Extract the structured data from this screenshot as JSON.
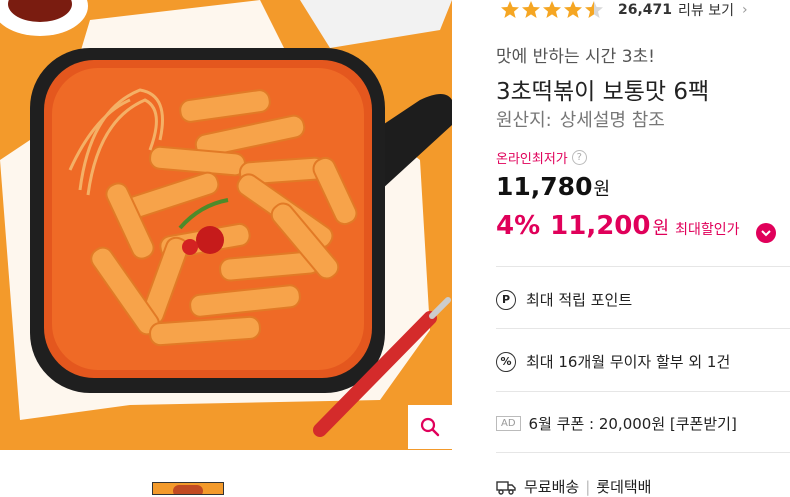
{
  "product": {
    "rating_stars": 4.5,
    "review_count": "26,471",
    "review_link": "리뷰 보기",
    "promo_text": "맛에 반하는 시간 3초!",
    "title": "3초떡볶이 보통맛 6팩",
    "origin_label": "원산지:",
    "origin_value": "상세설명 참조",
    "lowest_label": "온라인최저가",
    "price": "11,780",
    "won": "원",
    "discount_pct": "4%",
    "sale_price": "11,200",
    "max_discount": "최대할인가"
  },
  "benefits": {
    "points": "최대 적립 포인트",
    "installment": "최대 16개월 무이자 할부 외 1건",
    "ad_badge": "AD",
    "coupon": "6월 쿠폰 : 20,000원 [쿠폰받기]",
    "shipping": "무료배송",
    "courier": "롯데택배"
  },
  "icons": {
    "points": "P",
    "installment": "%"
  },
  "colors": {
    "accent": "#e0005a",
    "star": "#f5a623",
    "photo_bg": "#f39a2b"
  }
}
